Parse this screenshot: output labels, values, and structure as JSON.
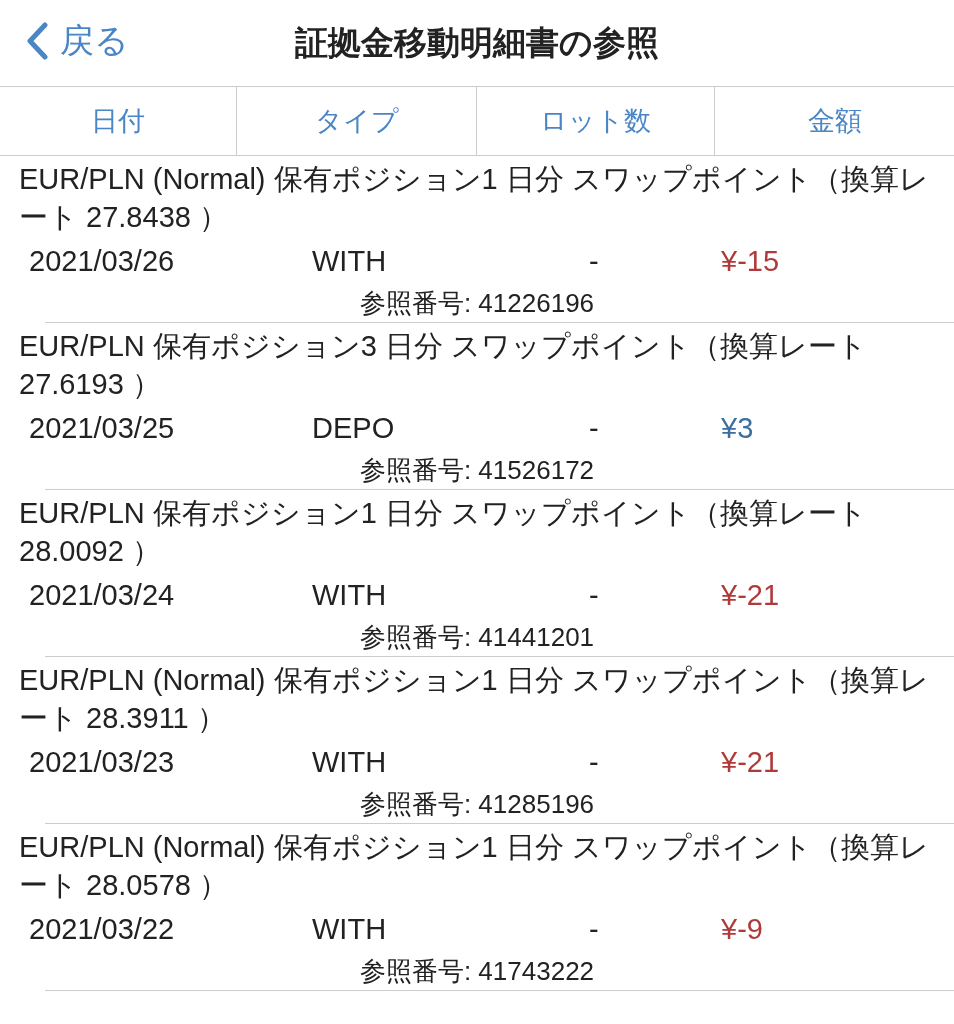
{
  "nav": {
    "back_label": "戻る",
    "title": "証拠金移動明細書の参照"
  },
  "columns": [
    "日付",
    "タイプ",
    "ロット数",
    "金額"
  ],
  "entries": [
    {
      "description": "EUR/PLN (Normal) 保有ポジション1 日分 スワップポイント（換算レート 27.8438 ）",
      "date": "2021/03/26",
      "type": "WITH",
      "lots": "-",
      "amount": "¥-15",
      "color": "#b03a3a",
      "reference": "参照番号: 41226196"
    },
    {
      "description": "EUR/PLN 保有ポジション3 日分 スワップポイント（換算レート 27.6193 ）",
      "date": "2021/03/25",
      "type": "DEPO",
      "lots": "-",
      "amount": "¥3",
      "color": "#3d6f9e",
      "reference": "参照番号: 41526172"
    },
    {
      "description": "EUR/PLN 保有ポジション1 日分 スワップポイント（換算レート 28.0092 ）",
      "date": "2021/03/24",
      "type": "WITH",
      "lots": "-",
      "amount": "¥-21",
      "color": "#b03a3a",
      "reference": "参照番号: 41441201"
    },
    {
      "description": "EUR/PLN (Normal) 保有ポジション1 日分 スワップポイント（換算レート 28.3911 ）",
      "date": "2021/03/23",
      "type": "WITH",
      "lots": "-",
      "amount": "¥-21",
      "color": "#b03a3a",
      "reference": "参照番号: 41285196"
    },
    {
      "description": "EUR/PLN (Normal) 保有ポジション1 日分 スワップポイント（換算レート 28.0578 ）",
      "date": "2021/03/22",
      "type": "WITH",
      "lots": "-",
      "amount": "¥-9",
      "color": "#b03a3a",
      "reference": "参照番号: 41743222"
    }
  ]
}
